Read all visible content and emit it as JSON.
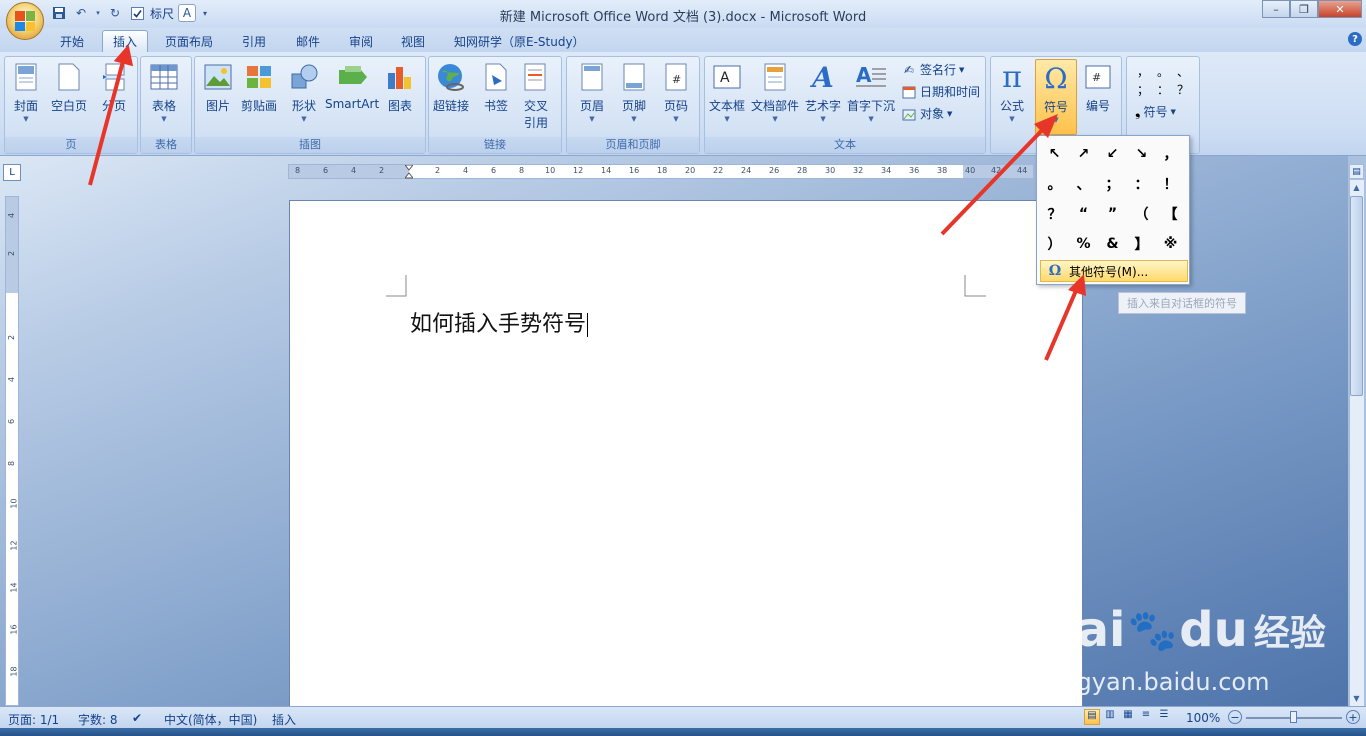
{
  "window": {
    "title": "新建 Microsoft Office Word 文档 (3).docx - Microsoft Word",
    "minimize": "–",
    "maximize": "❐",
    "close": "✕"
  },
  "qat": {
    "ruler_label": "标尺"
  },
  "tabs": [
    "开始",
    "插入",
    "页面布局",
    "引用",
    "邮件",
    "审阅",
    "视图",
    "知网研学（原E-Study）"
  ],
  "ribbon": {
    "groups": {
      "pages": {
        "label": "页",
        "buttons": [
          "封面",
          "空白页",
          "分页"
        ]
      },
      "tables": {
        "label": "表格",
        "buttons": [
          "表格"
        ]
      },
      "illustrations": {
        "label": "插图",
        "buttons": [
          "图片",
          "剪贴画",
          "形状",
          "SmartArt",
          "图表"
        ]
      },
      "links": {
        "label": "链接",
        "buttons": [
          "超链接",
          "书签",
          "交叉",
          "引用"
        ]
      },
      "header_footer": {
        "label": "页眉和页脚",
        "buttons": [
          "页眉",
          "页脚",
          "页码"
        ]
      },
      "text": {
        "label": "文本",
        "buttons": [
          "文本框",
          "文档部件",
          "艺术字",
          "首字下沉"
        ],
        "small": [
          "签名行",
          "日期和时间",
          "对象"
        ]
      },
      "symbols": {
        "buttons": [
          "公式",
          "符号",
          "编号"
        ]
      },
      "special": {
        "symbol_label": "符号",
        "chars": [
          "，",
          "。",
          "、",
          "；",
          "：",
          "？"
        ]
      }
    }
  },
  "ruler": {
    "left_nums": [
      "8",
      "6",
      "4",
      "2"
    ],
    "right_nums": [
      "2",
      "4",
      "6",
      "8",
      "10",
      "12",
      "14",
      "16",
      "18",
      "20",
      "22",
      "24",
      "26",
      "28",
      "30",
      "32",
      "34",
      "36",
      "38",
      "40",
      "42",
      "44"
    ],
    "v_nums": [
      "4",
      "2",
      "2",
      "4",
      "6",
      "8",
      "10",
      "12",
      "14",
      "16",
      "18"
    ]
  },
  "document": {
    "text": "如何插入手势符号"
  },
  "symbol_dropdown": {
    "symbols": [
      "↖",
      "↗",
      "↙",
      "↘",
      "，",
      "。",
      "、",
      "；",
      "：",
      "！",
      "？",
      "“",
      "”",
      "（",
      "【",
      "）",
      "%",
      "&",
      "】",
      "※"
    ],
    "more_label": "其他符号(M)...",
    "tooltip": "插入来自对话框的符号"
  },
  "status": {
    "page": "页面: 1/1",
    "words": "字数: 8",
    "language": "中文(简体，中国)",
    "mode": "插入",
    "zoom": "100%"
  },
  "watermark": {
    "brand": "Bai",
    "brand2": "du",
    "cn": "经验",
    "url": "jingyan.baidu.com"
  }
}
